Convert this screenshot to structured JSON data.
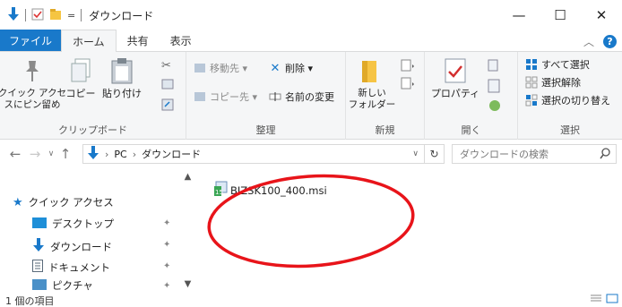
{
  "window": {
    "title": "ダウンロード",
    "quick_access_dropdown": "=",
    "minimize": "—",
    "maximize": "☐",
    "close": "✕"
  },
  "ribbon_tabs": [
    {
      "label": "ファイル"
    },
    {
      "label": "ホーム"
    },
    {
      "label": "共有"
    },
    {
      "label": "表示"
    }
  ],
  "ribbon": {
    "clipboard": {
      "pin_label": "クイック アクセ\nスにピン留め",
      "copy_label": "コピー",
      "paste_label": "貼り付け",
      "group_label": "クリップボード"
    },
    "organize": {
      "move_to": "移動先 ▾",
      "delete": "削除 ▾",
      "copy_to": "コピー先 ▾",
      "rename": "名前の変更",
      "group_label": "整理"
    },
    "new": {
      "new_folder": "新しい\nフォルダー",
      "group_label": "新規"
    },
    "open": {
      "properties": "プロパティ",
      "group_label": "開く"
    },
    "select": {
      "select_all": "すべて選択",
      "select_none": "選択解除",
      "invert": "選択の切り替え",
      "group_label": "選択"
    }
  },
  "address": {
    "path": [
      "PC",
      "ダウンロード"
    ],
    "search_placeholder": "ダウンロードの検索"
  },
  "nav_pane": {
    "items": [
      {
        "label": "クイック アクセス",
        "icon": "star-icon"
      },
      {
        "label": "デスクトップ",
        "icon": "desktop-icon"
      },
      {
        "label": "ダウンロード",
        "icon": "download-icon"
      },
      {
        "label": "ドキュメント",
        "icon": "document-icon"
      },
      {
        "label": "ピクチャ",
        "icon": "pictures-icon"
      }
    ]
  },
  "files": [
    {
      "name": "BIZSK100_400.msi",
      "icon": "msi-installer-icon"
    }
  ],
  "status": {
    "item_count": "1 個の項目"
  },
  "colors": {
    "accent": "#1979ca",
    "annotation_red": "#e8141a"
  }
}
